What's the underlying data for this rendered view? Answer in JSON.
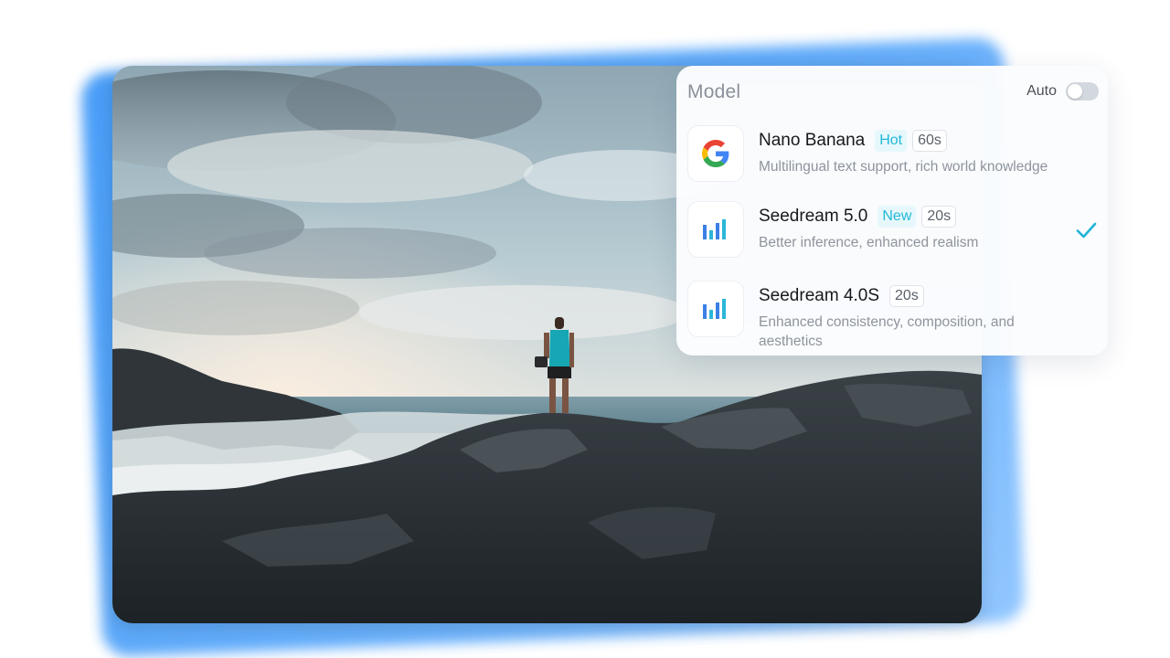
{
  "panel": {
    "title": "Model",
    "auto_label": "Auto",
    "auto_enabled": false
  },
  "models": [
    {
      "name": "Nano Banana",
      "tag": "Hot",
      "time": "60s",
      "description": "Multilingual text support, rich world knowledge",
      "icon": "google-logo-icon",
      "selected": false
    },
    {
      "name": "Seedream 5.0",
      "tag": "New",
      "time": "20s",
      "description": "Better inference, enhanced realism",
      "icon": "seedream-logo-icon",
      "selected": true
    },
    {
      "name": "Seedream 4.0S",
      "time": "20s",
      "description": "Enhanced consistency, composition, and aesthetics",
      "icon": "seedream-logo-icon",
      "selected": false
    }
  ],
  "colors": {
    "accent": "#22b8d8",
    "backdrop": "#4a9ff8",
    "check": "#1fb3d6"
  }
}
